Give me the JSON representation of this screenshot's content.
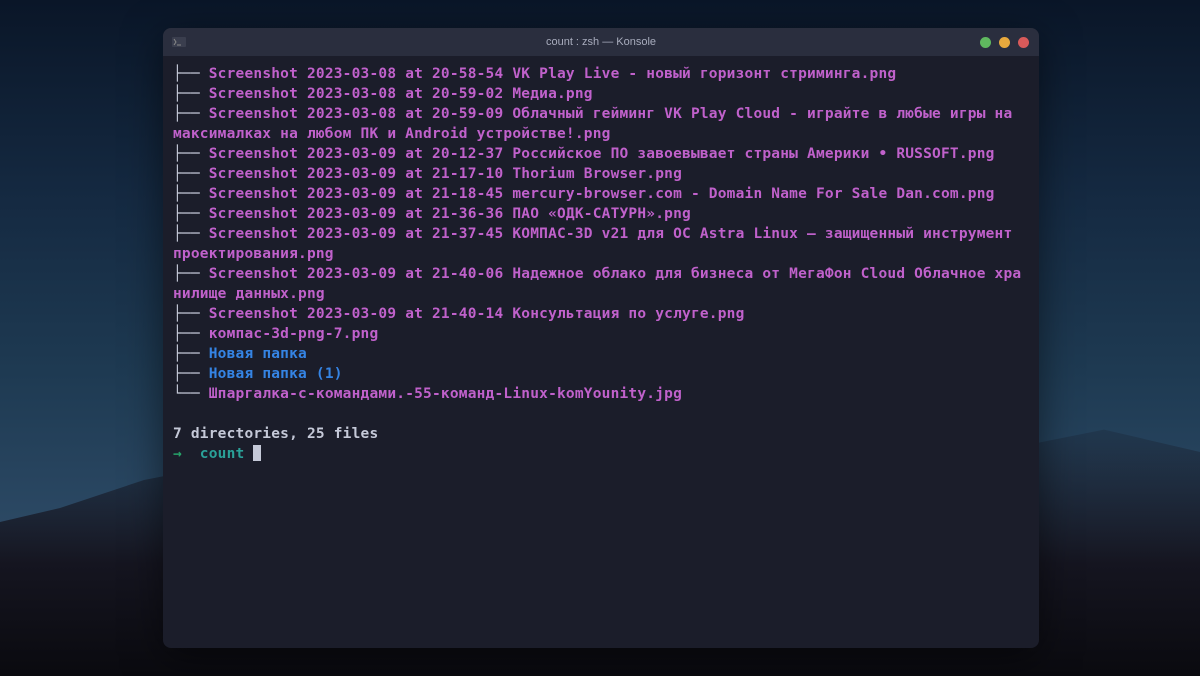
{
  "window": {
    "title": "count : zsh — Konsole"
  },
  "tree": {
    "lines": [
      {
        "prefix": "├── ",
        "filename": "Screenshot 2023-03-08 at 20-58-54 VK Play Live - новый горизонт стриминга.png",
        "type": "file"
      },
      {
        "prefix": "├── ",
        "filename": "Screenshot 2023-03-08 at 20-59-02 Медиа.png",
        "type": "file"
      },
      {
        "prefix": "├── ",
        "filename": "Screenshot 2023-03-08 at 20-59-09 Облачный гейминг VK Play Cloud - играйте в любые игры на максималках на любом ПК и Android устройстве!.png",
        "type": "file"
      },
      {
        "prefix": "├── ",
        "filename": "Screenshot 2023-03-09 at 20-12-37 Российское ПО завоевывает страны Америки • RUSSOFT.png",
        "type": "file"
      },
      {
        "prefix": "├── ",
        "filename": "Screenshot 2023-03-09 at 21-17-10 Thorium Browser.png",
        "type": "file"
      },
      {
        "prefix": "├── ",
        "filename": "Screenshot 2023-03-09 at 21-18-45 mercury-browser.com - Domain Name For Sale Dan.com.png",
        "type": "file"
      },
      {
        "prefix": "├── ",
        "filename": "Screenshot 2023-03-09 at 21-36-36 ПАО «ОДК-САТУРН».png",
        "type": "file"
      },
      {
        "prefix": "├── ",
        "filename": "Screenshot 2023-03-09 at 21-37-45 КОМПАС-3D v21 для ОС Astra Linux — защищенный инструмент проектирования.png",
        "type": "file"
      },
      {
        "prefix": "├── ",
        "filename": "Screenshot 2023-03-09 at 21-40-06 Надежное облако для бизнеса от МегаФон Cloud Облачное хранилище данных.png",
        "type": "file"
      },
      {
        "prefix": "├── ",
        "filename": "Screenshot 2023-03-09 at 21-40-14 Консультация по услуге.png",
        "type": "file"
      },
      {
        "prefix": "├── ",
        "filename": "компас-3d-png-7.png",
        "type": "file"
      },
      {
        "prefix": "├── ",
        "filename": "Новая папка",
        "type": "dir"
      },
      {
        "prefix": "├── ",
        "filename": "Новая папка (1)",
        "type": "dir"
      },
      {
        "prefix": "└── ",
        "filename": "Шпаргалка-с-командами.-55-команд-Linux-komYounity.jpg",
        "type": "file"
      }
    ]
  },
  "summary": "7 directories, 25 files",
  "prompt": {
    "arrow": "→ ",
    "text": " count "
  }
}
